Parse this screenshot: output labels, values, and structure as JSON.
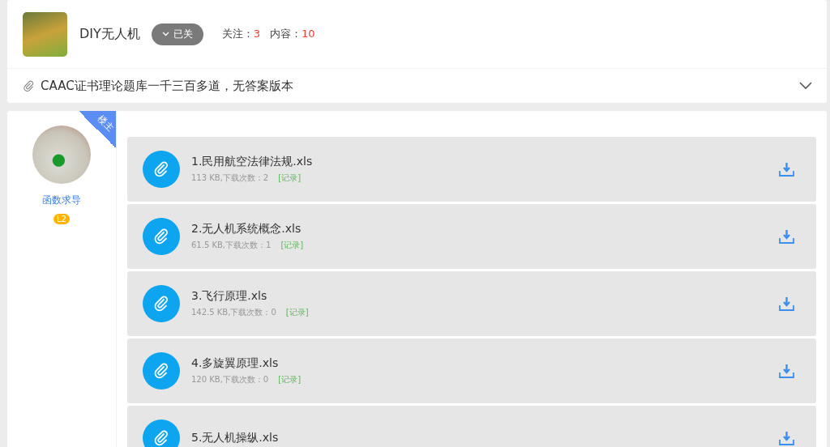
{
  "group": {
    "name": "DIY无人机",
    "follow_button": {
      "label": "已关",
      "followed": true
    },
    "stats": [
      {
        "label": "关注：",
        "value": "3"
      },
      {
        "label": "内容：",
        "value": "10"
      }
    ]
  },
  "post_title": "CAAC证书理论题库一千三百多道，无答案版本",
  "author": {
    "ribbon": "楼主",
    "name": "函数求导",
    "level": "L2"
  },
  "files": [
    {
      "name": "1.民用航空法律法规.xls",
      "meta": "113 KB,下载次数：2",
      "log": "[记录]"
    },
    {
      "name": "2.无人机系统概念.xls",
      "meta": "61.5 KB,下载次数：1",
      "log": "[记录]"
    },
    {
      "name": "3.飞行原理.xls",
      "meta": "142.5 KB,下载次数：0",
      "log": "[记录]"
    },
    {
      "name": "4.多旋翼原理.xls",
      "meta": "120 KB,下载次数：0",
      "log": "[记录]"
    },
    {
      "name": "5.无人机操纵.xls"
    }
  ]
}
